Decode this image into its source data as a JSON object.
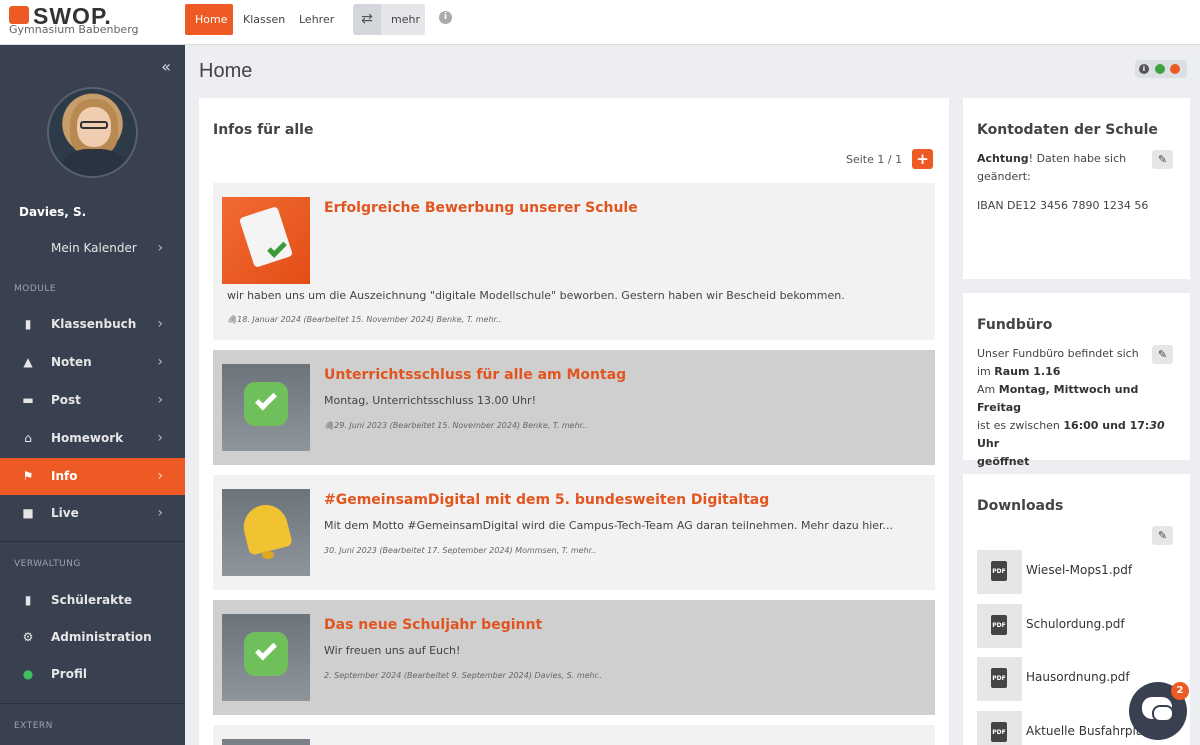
{
  "header": {
    "logo_text": "SWOP.",
    "school": "Gymnasium Babenberg",
    "tabs": [
      "Home",
      "Klassen",
      "Lehrer"
    ],
    "more_label": "mehr",
    "swap_icon": "⇄",
    "info_icon": "i"
  },
  "sidebar": {
    "collapse_icon": "«",
    "user_name": "Davies, S.",
    "calendar_label": "Mein Kalender",
    "section_module": "MODULE",
    "modules": [
      "Klassenbuch",
      "Noten",
      "Post",
      "Homework",
      "Info",
      "Live"
    ],
    "section_verwaltung": "VERWALTUNG",
    "verwaltung": [
      "Schülerakte",
      "Administration",
      "Profil"
    ],
    "section_extern": "EXTERN",
    "chevron": "›"
  },
  "main": {
    "title": "Home",
    "status_info": "i",
    "status_colors": [
      "#555555",
      "#3fa33f",
      "#ee5a24"
    ],
    "infos": {
      "title": "Infos für alle",
      "page": "Seite 1 / 1",
      "add": "+",
      "posts": [
        {
          "title": "Erfolgreiche Bewerbung unserer Schule",
          "text": "wir haben uns um die Auszeichnung \"digitale Modellschule\" beworben. Gestern haben wir Bescheid bekommen.",
          "meta": "🖇18. Januar 2024  (Bearbeitet 15. November 2024)  Benke, T.  mehr.."
        },
        {
          "title": "Unterrichtsschluss für alle am Montag",
          "text": "Montag, Unterrichtsschluss 13.00 Uhr!",
          "meta": "🖇29. Juni 2023  (Bearbeitet 15. November 2024)  Benke, T.  mehr.."
        },
        {
          "title": "#GemeinsamDigital mit dem 5. bundesweiten Digitaltag",
          "text": "Mit dem Motto #GemeinsamDigital wird die Campus-Tech-Team AG daran teilnehmen. Mehr dazu hier...",
          "meta": "30. Juni 2023  (Bearbeitet 17. September 2024)  Mommsen, T.  mehr.."
        },
        {
          "title": "Das neue Schuljahr beginnt",
          "text": "Wir freuen uns auf Euch!",
          "meta": "2. September 2024  (Bearbeitet 9. September 2024)  Davies, S.  mehr.."
        }
      ]
    }
  },
  "right": {
    "konto": {
      "title": "Kontodaten der Schule",
      "achtung": "Achtung",
      "line1_rest": "! Daten habe sich",
      "line2": "geändert:",
      "iban": "IBAN DE12 3456 7890 1234 56"
    },
    "fund": {
      "title": "Fundbüro",
      "l1": "Unser Fundbüro befindet sich",
      "l2a": "im ",
      "l2b": "Raum 1.16",
      "l3a": "Am ",
      "l3b": "Montag, Mittwoch und Freitag",
      "l4a": "ist es zwischen ",
      "l4b": "16:00 und 17:",
      "l4c": "30",
      "l4d": " Uhr",
      "l5": "geöffnet"
    },
    "downloads": {
      "title": "Downloads",
      "files": [
        "Wiesel-Mops1.pdf",
        "Schulordung.pdf",
        "Hausordnung.pdf",
        "Aktuelle Busfahrpläne"
      ]
    },
    "edit_icon": "✎",
    "pdf_label": "PDF"
  },
  "chat": {
    "badge": "2"
  }
}
